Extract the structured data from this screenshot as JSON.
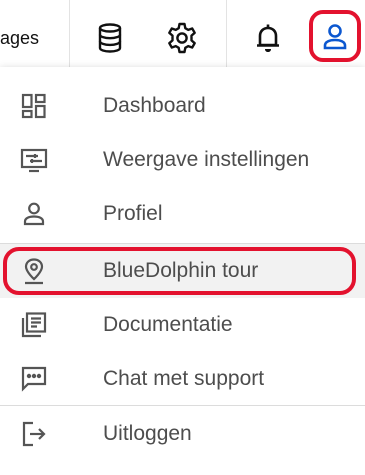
{
  "topbar": {
    "left_label": "ages",
    "icons": [
      "database-icon",
      "settings-gear-icon",
      "notification-bell-icon",
      "user-profile-icon"
    ],
    "profile_color": "#0b57d0",
    "highlight_color": "#e3122e"
  },
  "menu": {
    "items": [
      {
        "label": "Dashboard",
        "icon": "dashboard-icon"
      },
      {
        "label": "Weergave instellingen",
        "icon": "display-settings-icon"
      },
      {
        "label": "Profiel",
        "icon": "person-icon"
      },
      {
        "label": "BlueDolphin tour",
        "icon": "location-pin-icon"
      },
      {
        "label": "Documentatie",
        "icon": "library-books-icon"
      },
      {
        "label": "Chat met support",
        "icon": "chat-bubble-icon"
      },
      {
        "label": "Uitloggen",
        "icon": "logout-icon"
      }
    ],
    "active_item": "BlueDolphin tour"
  }
}
